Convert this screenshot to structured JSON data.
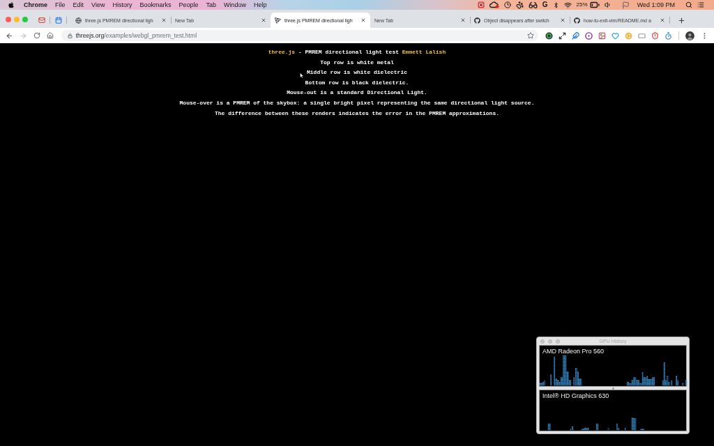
{
  "menu_bar": {
    "app": "Chrome",
    "menus": [
      "File",
      "Edit",
      "View",
      "History",
      "Bookmarks",
      "People",
      "Tab",
      "Window",
      "Help"
    ],
    "status": {
      "letter_icon": "G",
      "battery": "25%",
      "clock": "Wed 1:09 PM"
    }
  },
  "tabs": [
    {
      "kind": "pinned",
      "selected": false
    },
    {
      "kind": "pinned",
      "selected": false
    },
    {
      "kind": "page",
      "title": "three.js PMREM directional ligh",
      "selected": false
    },
    {
      "kind": "newtab",
      "title": "New Tab",
      "selected": false
    },
    {
      "kind": "page",
      "title": "three.js PMREM directional ligh",
      "selected": true
    },
    {
      "kind": "newtab",
      "title": "New Tab",
      "selected": false
    },
    {
      "kind": "page",
      "title": "Object disappears after switch",
      "selected": false
    },
    {
      "kind": "page",
      "title": "how-to-exit-vim/README.md a",
      "selected": false
    }
  ],
  "toolbar": {
    "forward": {
      "disabled": true
    },
    "url": {
      "host": "threejs.org",
      "path": "/examples/webgl_pmrem_test.html"
    }
  },
  "page": {
    "title": {
      "link": "three.js",
      "text": "- PMREM directional light test",
      "author": "Emmett Lalish"
    },
    "lines": [
      "Top row is white metal",
      "Middle row is white dielectric",
      "Bottom row is black dielectric.",
      "Mouse-out is a standard Directional Light.",
      "Mouse-over is a PMREM of the skybox: a single bright pixel representing the same directional light source.",
      "The difference between these renders indicates the error in the PMREM approximations."
    ]
  },
  "gpu_history": {
    "title": "GPU History",
    "panels": [
      {
        "name": "AMD Radeon Pro 560"
      },
      {
        "name": "Intel® HD Graphics 630"
      }
    ]
  }
}
